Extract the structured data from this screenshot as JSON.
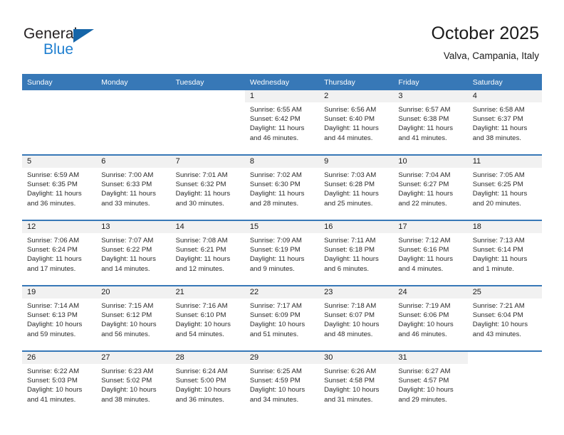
{
  "brand": {
    "name_top": "General",
    "name_bottom": "Blue",
    "accent_color": "#1f7fd0",
    "triangle_color": "#1565a8"
  },
  "header": {
    "title": "October 2025",
    "subtitle": "Valva, Campania, Italy"
  },
  "theme": {
    "header_row_bg": "#3778b7",
    "daynum_bg": "#f1f1f1",
    "text_color": "#1a1a1a"
  },
  "weekdays": [
    "Sunday",
    "Monday",
    "Tuesday",
    "Wednesday",
    "Thursday",
    "Friday",
    "Saturday"
  ],
  "weeks": [
    [
      {
        "day": "",
        "blank": true
      },
      {
        "day": "",
        "blank": true
      },
      {
        "day": "",
        "blank": true
      },
      {
        "day": "1",
        "sunrise": "Sunrise: 6:55 AM",
        "sunset": "Sunset: 6:42 PM",
        "daylight1": "Daylight: 11 hours",
        "daylight2": "and 46 minutes."
      },
      {
        "day": "2",
        "sunrise": "Sunrise: 6:56 AM",
        "sunset": "Sunset: 6:40 PM",
        "daylight1": "Daylight: 11 hours",
        "daylight2": "and 44 minutes."
      },
      {
        "day": "3",
        "sunrise": "Sunrise: 6:57 AM",
        "sunset": "Sunset: 6:38 PM",
        "daylight1": "Daylight: 11 hours",
        "daylight2": "and 41 minutes."
      },
      {
        "day": "4",
        "sunrise": "Sunrise: 6:58 AM",
        "sunset": "Sunset: 6:37 PM",
        "daylight1": "Daylight: 11 hours",
        "daylight2": "and 38 minutes."
      }
    ],
    [
      {
        "day": "5",
        "sunrise": "Sunrise: 6:59 AM",
        "sunset": "Sunset: 6:35 PM",
        "daylight1": "Daylight: 11 hours",
        "daylight2": "and 36 minutes."
      },
      {
        "day": "6",
        "sunrise": "Sunrise: 7:00 AM",
        "sunset": "Sunset: 6:33 PM",
        "daylight1": "Daylight: 11 hours",
        "daylight2": "and 33 minutes."
      },
      {
        "day": "7",
        "sunrise": "Sunrise: 7:01 AM",
        "sunset": "Sunset: 6:32 PM",
        "daylight1": "Daylight: 11 hours",
        "daylight2": "and 30 minutes."
      },
      {
        "day": "8",
        "sunrise": "Sunrise: 7:02 AM",
        "sunset": "Sunset: 6:30 PM",
        "daylight1": "Daylight: 11 hours",
        "daylight2": "and 28 minutes."
      },
      {
        "day": "9",
        "sunrise": "Sunrise: 7:03 AM",
        "sunset": "Sunset: 6:28 PM",
        "daylight1": "Daylight: 11 hours",
        "daylight2": "and 25 minutes."
      },
      {
        "day": "10",
        "sunrise": "Sunrise: 7:04 AM",
        "sunset": "Sunset: 6:27 PM",
        "daylight1": "Daylight: 11 hours",
        "daylight2": "and 22 minutes."
      },
      {
        "day": "11",
        "sunrise": "Sunrise: 7:05 AM",
        "sunset": "Sunset: 6:25 PM",
        "daylight1": "Daylight: 11 hours",
        "daylight2": "and 20 minutes."
      }
    ],
    [
      {
        "day": "12",
        "sunrise": "Sunrise: 7:06 AM",
        "sunset": "Sunset: 6:24 PM",
        "daylight1": "Daylight: 11 hours",
        "daylight2": "and 17 minutes."
      },
      {
        "day": "13",
        "sunrise": "Sunrise: 7:07 AM",
        "sunset": "Sunset: 6:22 PM",
        "daylight1": "Daylight: 11 hours",
        "daylight2": "and 14 minutes."
      },
      {
        "day": "14",
        "sunrise": "Sunrise: 7:08 AM",
        "sunset": "Sunset: 6:21 PM",
        "daylight1": "Daylight: 11 hours",
        "daylight2": "and 12 minutes."
      },
      {
        "day": "15",
        "sunrise": "Sunrise: 7:09 AM",
        "sunset": "Sunset: 6:19 PM",
        "daylight1": "Daylight: 11 hours",
        "daylight2": "and 9 minutes."
      },
      {
        "day": "16",
        "sunrise": "Sunrise: 7:11 AM",
        "sunset": "Sunset: 6:18 PM",
        "daylight1": "Daylight: 11 hours",
        "daylight2": "and 6 minutes."
      },
      {
        "day": "17",
        "sunrise": "Sunrise: 7:12 AM",
        "sunset": "Sunset: 6:16 PM",
        "daylight1": "Daylight: 11 hours",
        "daylight2": "and 4 minutes."
      },
      {
        "day": "18",
        "sunrise": "Sunrise: 7:13 AM",
        "sunset": "Sunset: 6:14 PM",
        "daylight1": "Daylight: 11 hours",
        "daylight2": "and 1 minute."
      }
    ],
    [
      {
        "day": "19",
        "sunrise": "Sunrise: 7:14 AM",
        "sunset": "Sunset: 6:13 PM",
        "daylight1": "Daylight: 10 hours",
        "daylight2": "and 59 minutes."
      },
      {
        "day": "20",
        "sunrise": "Sunrise: 7:15 AM",
        "sunset": "Sunset: 6:12 PM",
        "daylight1": "Daylight: 10 hours",
        "daylight2": "and 56 minutes."
      },
      {
        "day": "21",
        "sunrise": "Sunrise: 7:16 AM",
        "sunset": "Sunset: 6:10 PM",
        "daylight1": "Daylight: 10 hours",
        "daylight2": "and 54 minutes."
      },
      {
        "day": "22",
        "sunrise": "Sunrise: 7:17 AM",
        "sunset": "Sunset: 6:09 PM",
        "daylight1": "Daylight: 10 hours",
        "daylight2": "and 51 minutes."
      },
      {
        "day": "23",
        "sunrise": "Sunrise: 7:18 AM",
        "sunset": "Sunset: 6:07 PM",
        "daylight1": "Daylight: 10 hours",
        "daylight2": "and 48 minutes."
      },
      {
        "day": "24",
        "sunrise": "Sunrise: 7:19 AM",
        "sunset": "Sunset: 6:06 PM",
        "daylight1": "Daylight: 10 hours",
        "daylight2": "and 46 minutes."
      },
      {
        "day": "25",
        "sunrise": "Sunrise: 7:21 AM",
        "sunset": "Sunset: 6:04 PM",
        "daylight1": "Daylight: 10 hours",
        "daylight2": "and 43 minutes."
      }
    ],
    [
      {
        "day": "26",
        "sunrise": "Sunrise: 6:22 AM",
        "sunset": "Sunset: 5:03 PM",
        "daylight1": "Daylight: 10 hours",
        "daylight2": "and 41 minutes."
      },
      {
        "day": "27",
        "sunrise": "Sunrise: 6:23 AM",
        "sunset": "Sunset: 5:02 PM",
        "daylight1": "Daylight: 10 hours",
        "daylight2": "and 38 minutes."
      },
      {
        "day": "28",
        "sunrise": "Sunrise: 6:24 AM",
        "sunset": "Sunset: 5:00 PM",
        "daylight1": "Daylight: 10 hours",
        "daylight2": "and 36 minutes."
      },
      {
        "day": "29",
        "sunrise": "Sunrise: 6:25 AM",
        "sunset": "Sunset: 4:59 PM",
        "daylight1": "Daylight: 10 hours",
        "daylight2": "and 34 minutes."
      },
      {
        "day": "30",
        "sunrise": "Sunrise: 6:26 AM",
        "sunset": "Sunset: 4:58 PM",
        "daylight1": "Daylight: 10 hours",
        "daylight2": "and 31 minutes."
      },
      {
        "day": "31",
        "sunrise": "Sunrise: 6:27 AM",
        "sunset": "Sunset: 4:57 PM",
        "daylight1": "Daylight: 10 hours",
        "daylight2": "and 29 minutes."
      },
      {
        "day": "",
        "blank": true
      }
    ]
  ]
}
